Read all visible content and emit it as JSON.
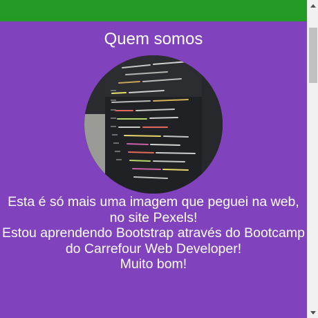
{
  "colors": {
    "top_bar": "#239a23",
    "section_bg": "#8142bd",
    "text": "#ffffff"
  },
  "about": {
    "title": "Quem somos",
    "image_icon": "code-screen-photo",
    "paragraph_1": "Esta é só mais uma imagem que peguei na web, no site Pexels!",
    "paragraph_2": "Estou aprendendo Bootstrap através do Bootcamp do Carrefour Web Developer!",
    "paragraph_3": "Muito bom!"
  },
  "scrollbar": {
    "up_icon": "scroll-up-arrow-icon",
    "down_icon": "scroll-down-arrow-icon"
  }
}
